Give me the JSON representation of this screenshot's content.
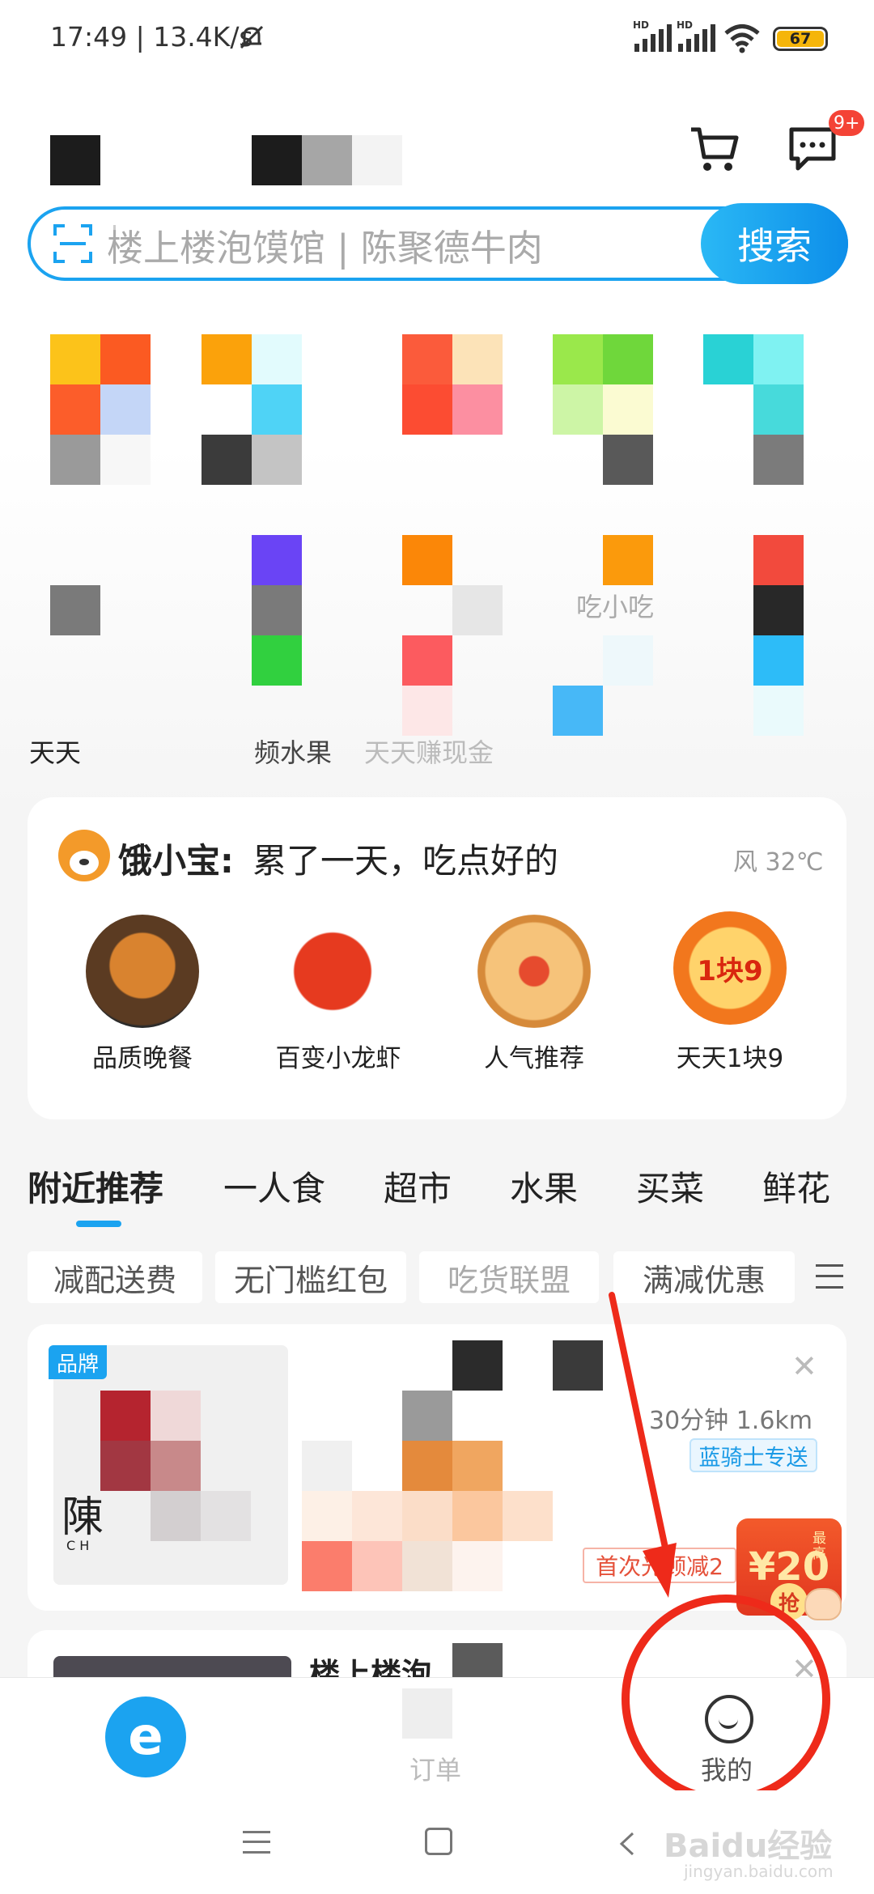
{
  "status_bar": {
    "time_speed": "17:49 | 13.4K/s",
    "battery": "67",
    "hd": "HD"
  },
  "header": {
    "notification_badge": "9+"
  },
  "search": {
    "placeholder": "楼上楼泡馍馆 | 陈聚德牛肉",
    "button_label": "搜索"
  },
  "categories": {
    "row2_label_1": "天天",
    "row2_label_3": "频水果",
    "row2_label_4": "天天赚现金",
    "row2_label_5": "吃小吃"
  },
  "promo": {
    "brand": "饿小宝:",
    "tagline": "累了一天，吃点好的",
    "weather": "风 32℃",
    "items": [
      {
        "label": "品质晚餐"
      },
      {
        "label": "百变小龙虾"
      },
      {
        "label": "人气推荐"
      },
      {
        "label": "天天1块9"
      }
    ],
    "badge_text": "1块9"
  },
  "tabs": [
    {
      "label": "附近推荐"
    },
    {
      "label": "一人食"
    },
    {
      "label": "超市"
    },
    {
      "label": "水果"
    },
    {
      "label": "买菜"
    },
    {
      "label": "鲜花"
    }
  ],
  "filters": [
    {
      "label": "减配送费"
    },
    {
      "label": "无门槛红包"
    },
    {
      "label": "吃货联盟"
    },
    {
      "label": "满减优惠"
    }
  ],
  "shop": {
    "brand_badge": "品牌",
    "distance": "30分钟 1.6km",
    "delivery": "蓝骑士专送",
    "coupon": "首次光顾减2",
    "redpack": "¥20",
    "redpack_action": "抢",
    "redpack_corner": "最高",
    "logo_letter": "陳",
    "logo_sub": "C H"
  },
  "shop2": {
    "title": "楼上楼泡"
  },
  "bottom_nav": {
    "orders": "订单",
    "me": "我的"
  },
  "watermark": {
    "text": "Baidu经验",
    "sub": "jingyan.baidu.com"
  },
  "colors": {
    "accent": "#1ba3f0",
    "annotation": "#ee2a1a"
  }
}
